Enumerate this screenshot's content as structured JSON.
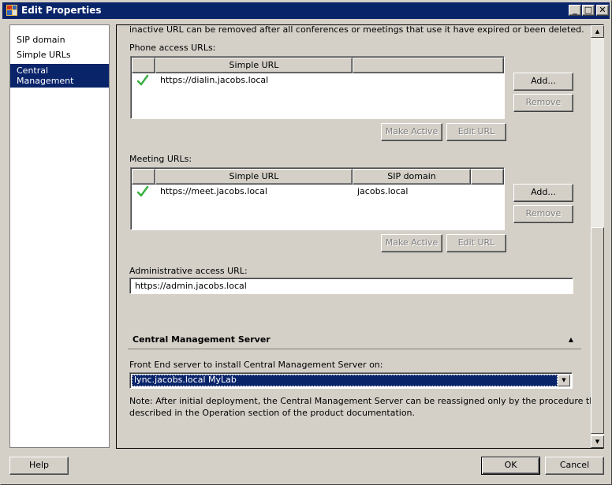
{
  "window": {
    "title": "Edit Properties",
    "controls": {
      "minimize": "_",
      "maximize": "□",
      "close": "✕"
    }
  },
  "sidebar": {
    "items": [
      {
        "label": "SIP domain",
        "selected": false
      },
      {
        "label": "Simple URLs",
        "selected": false
      },
      {
        "label": "Central Management Server",
        "selected": true
      }
    ]
  },
  "content": {
    "intro_text": "inactive URL can be removed after all conferences or meetings that use it have expired or been deleted.",
    "phone_access": {
      "label": "Phone access URLs:",
      "columns": [
        "",
        "Simple URL",
        ""
      ],
      "rows": [
        {
          "active": true,
          "url": "https://dialin.jacobs.local"
        }
      ],
      "add_label": "Add...",
      "remove_label": "Remove",
      "make_active_label": "Make Active",
      "edit_url_label": "Edit URL"
    },
    "meeting": {
      "label": "Meeting URLs:",
      "columns": [
        "",
        "Simple URL",
        "SIP domain",
        ""
      ],
      "rows": [
        {
          "active": true,
          "url": "https://meet.jacobs.local",
          "sip_domain": "jacobs.local"
        }
      ],
      "add_label": "Add...",
      "remove_label": "Remove",
      "make_active_label": "Make Active",
      "edit_url_label": "Edit URL"
    },
    "admin": {
      "label": "Administrative access URL:",
      "value": "https://admin.jacobs.local"
    },
    "cms_section": {
      "title": "Central Management Server",
      "front_end_label": "Front End server to install Central Management Server on:",
      "front_end_value": "lync.jacobs.local   MyLab",
      "note_line1": "Note: After initial deployment, the Central Management Server can be reassigned only by the procedure that is",
      "note_line2": "described in the Operation section of the product documentation."
    }
  },
  "footer": {
    "help_label": "Help",
    "ok_label": "OK",
    "cancel_label": "Cancel"
  },
  "colors": {
    "titlebar": "#0a246a",
    "selection": "#0a246a",
    "face": "#d4d0c8",
    "check": "#3cb043"
  }
}
